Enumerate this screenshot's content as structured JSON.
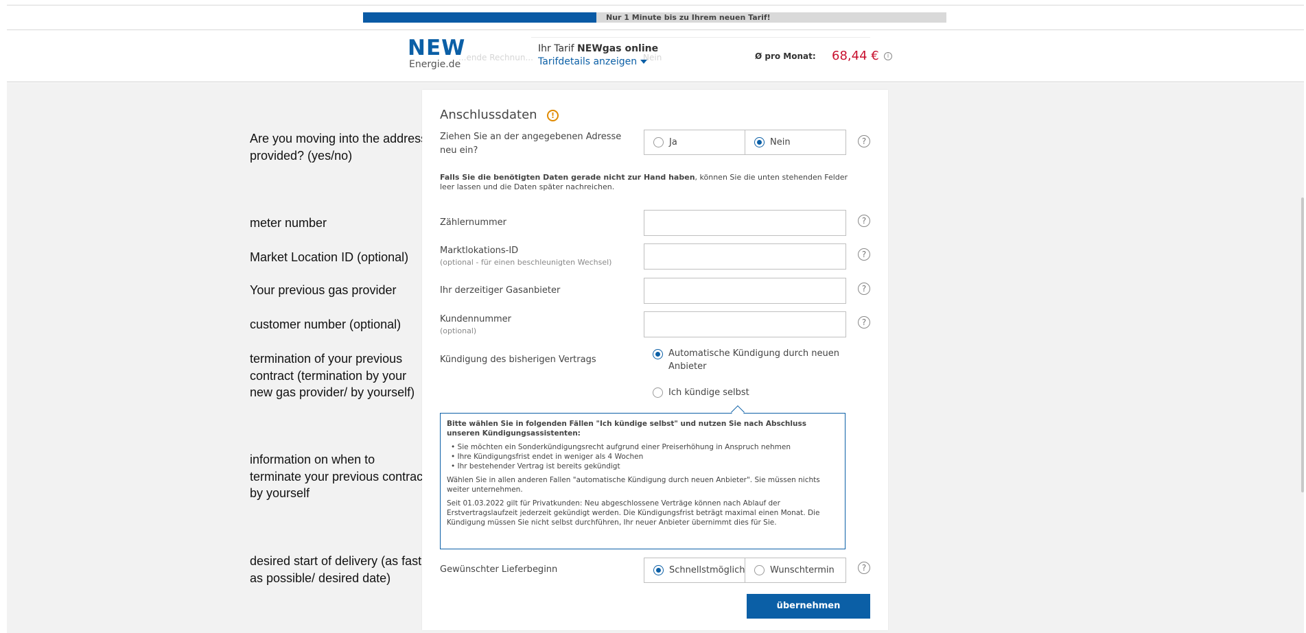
{
  "progress": {
    "value": 0.4,
    "text": "Nur 1 Minute bis zu Ihrem neuen Tarif!"
  },
  "header": {
    "logo_main": "NEW",
    "logo_sub": "Energie.de",
    "ghost_left": "...ende Rechnun...",
    "ghost_right": "Nein",
    "tarif_prefix": "Ihr Tarif ",
    "tarif_name": "NEWgas online",
    "tarif_link": "Tarifdetails anzeigen",
    "per_month_label": "Ø pro Monat:",
    "price": "68,44 €",
    "info_icon": "i"
  },
  "annotations": {
    "moving": "Are you moving into the address provided? (yes/no)",
    "meter": "meter number",
    "market": "Market Location ID (optional)",
    "provider": "Your previous gas provider",
    "customer": "customer number (optional)",
    "termination": "termination of your previous contract (termination by your new gas provider/ by yourself)",
    "info": "information on when to terminate your previous contract by yourself",
    "delivery": "desired start of delivery (as fast as possible/ desired date)"
  },
  "form": {
    "title": "Anschlussdaten",
    "warn_icon": "!",
    "move_label": "Ziehen Sie an der angegebenen Adresse neu ein?",
    "move_yes": "Ja",
    "move_no": "Nein",
    "note_bold": "Falls Sie die benötigten Daten gerade nicht zur Hand haben",
    "note_rest": ", können Sie die unten stehenden Felder leer lassen und die Daten später nachreichen.",
    "meter_label": "Zählernummer",
    "malo_label": "Marktlokations-ID",
    "malo_sub": "(optional - für einen beschleunigten Wechsel)",
    "provider_label": "Ihr derzeitiger Gasanbieter",
    "customer_label": "Kundennummer",
    "customer_sub": "(optional)",
    "termination_label": "Kündigung des bisherigen Vertrags",
    "termination_auto": "Automatische Kündigung durch neuen Anbieter",
    "termination_self": "Ich kündige selbst",
    "info_head": "Bitte wählen Sie in folgenden Fällen \"Ich kündige selbst\" und nutzen Sie nach Abschluss unseren Kündigungsassistenten:",
    "info_items": [
      "Sie möchten ein Sonderkündigungsrecht aufgrund einer Preiserhöhung in Anspruch nehmen",
      "Ihre Kündigungsfrist endet in weniger als 4 Wochen",
      "Ihr bestehender Vertrag ist bereits gekündigt"
    ],
    "info_p1": "Wählen Sie in allen anderen Fallen \"automatische Kündigung durch neuen Anbieter\". Sie müssen nichts weiter unternehmen.",
    "info_p2": "Seit 01.03.2022 gilt für Privatkunden: Neu abgeschlossene Verträge können nach Ablauf der Erstvertragslaufzeit jederzeit gekündigt werden. Die Kündigungsfrist beträgt maximal einen Monat. Die Kündigung müssen Sie nicht selbst durchführen, Ihr neuer Anbieter übernimmt dies für Sie.",
    "delivery_label": "Gewünschter Lieferbeginn",
    "delivery_asap": "Schnellstmöglich",
    "delivery_date": "Wunschtermin",
    "help_icon": "?",
    "submit": "übernehmen"
  }
}
